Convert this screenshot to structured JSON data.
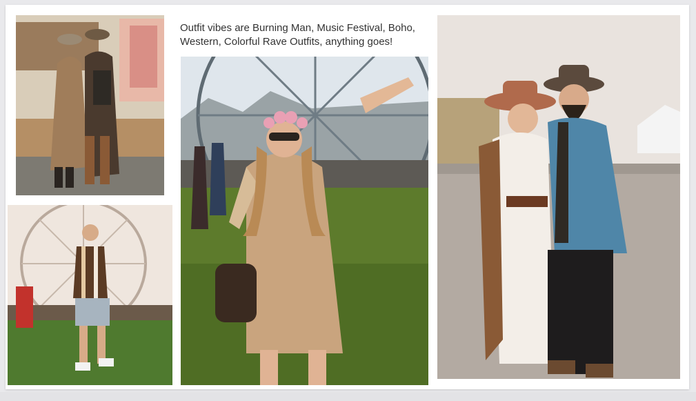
{
  "caption": "Outfit vibes are Burning Man, Music Festival, Boho, Western, Colorful Rave Outfits, anything goes!",
  "photos": [
    {
      "label": "two-women-boho-outfits"
    },
    {
      "label": "man-ferris-wheel-festival"
    },
    {
      "label": "woman-flower-crown-festival"
    },
    {
      "label": "couple-western-hats"
    }
  ]
}
